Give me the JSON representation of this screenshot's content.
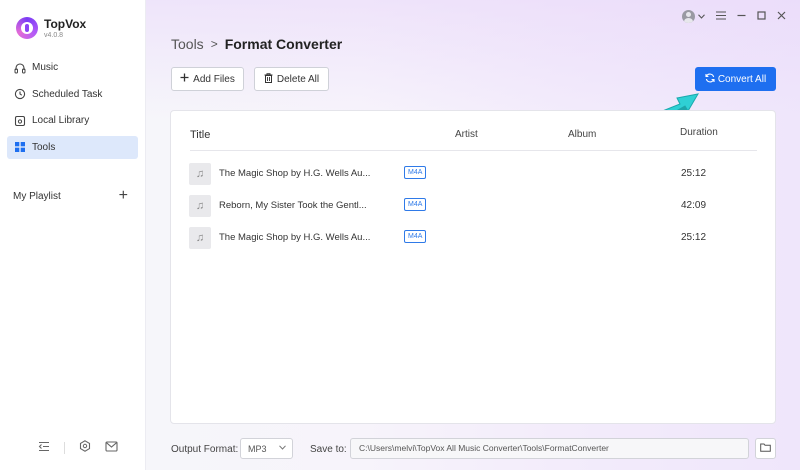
{
  "app": {
    "name": "TopVox",
    "version": "v4.0.8"
  },
  "sidebar": {
    "items": [
      {
        "label": "Music",
        "icon": "headphones-icon"
      },
      {
        "label": "Scheduled Task",
        "icon": "clock-icon"
      },
      {
        "label": "Local Library",
        "icon": "library-icon"
      },
      {
        "label": "Tools",
        "icon": "grid-icon",
        "active": true
      }
    ],
    "playlist_label": "My Playlist",
    "playlist_add": "+"
  },
  "breadcrumb": {
    "parent": "Tools",
    "separator": ">",
    "current": "Format Converter"
  },
  "toolbar": {
    "add_files": "Add Files",
    "delete_all": "Delete All",
    "convert_all": "Convert All"
  },
  "table": {
    "columns": {
      "title": "Title",
      "artist": "Artist",
      "album": "Album",
      "duration": "Duration"
    },
    "rows": [
      {
        "title": "The Magic Shop by H.G. Wells Au...",
        "format": "M4A",
        "artist": "",
        "album": "",
        "duration": "25:12"
      },
      {
        "title": "Reborn, My Sister Took the Gentl...",
        "format": "M4A",
        "artist": "",
        "album": "",
        "duration": "42:09"
      },
      {
        "title": "The Magic Shop by H.G. Wells Au...",
        "format": "M4A",
        "artist": "",
        "album": "",
        "duration": "25:12"
      }
    ]
  },
  "bottom": {
    "output_format_label": "Output Format:",
    "output_format_value": "MP3",
    "save_to_label": "Save to:",
    "save_to_path": "C:\\Users\\melvi\\TopVox All Music Converter\\Tools\\FormatConverter"
  },
  "colors": {
    "accent": "#1e6ff0",
    "active_nav": "#dde8fb",
    "badge": "#2f7ae8",
    "arrow": "#2fd0d4"
  }
}
